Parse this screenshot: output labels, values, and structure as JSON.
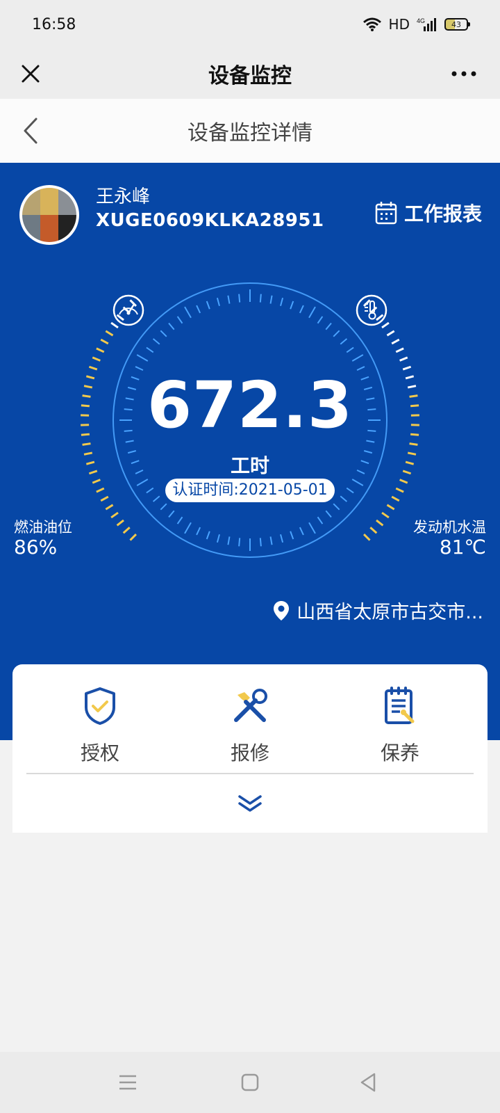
{
  "status_bar": {
    "time": "16:58",
    "network": "HD",
    "signal": "4G",
    "battery": "43"
  },
  "navbar": {
    "title": "设备监控"
  },
  "subnav": {
    "title": "设备监控详情"
  },
  "device": {
    "owner_name": "王永峰",
    "device_id": "XUGE0609KLKA28951",
    "report_label": "工作报表"
  },
  "gauge": {
    "hours_value": "672.3",
    "hours_unit": "工时",
    "cert_text": "认证时间:2021-05-01",
    "fuel_label": "燃油油位",
    "fuel_value": "86%",
    "fuel_level": 0.86,
    "temp_label": "发动机水温",
    "temp_value": "81℃"
  },
  "location": {
    "text": "山西省太原市古交市..."
  },
  "actions": [
    {
      "label": "授权",
      "icon": "shield-check-icon"
    },
    {
      "label": "报修",
      "icon": "wrench-icon"
    },
    {
      "label": "保养",
      "icon": "maintenance-doc-icon"
    }
  ],
  "colors": {
    "primary": "#0747a6",
    "accent": "#f2c94c",
    "light_blue": "#4aa3ff"
  }
}
